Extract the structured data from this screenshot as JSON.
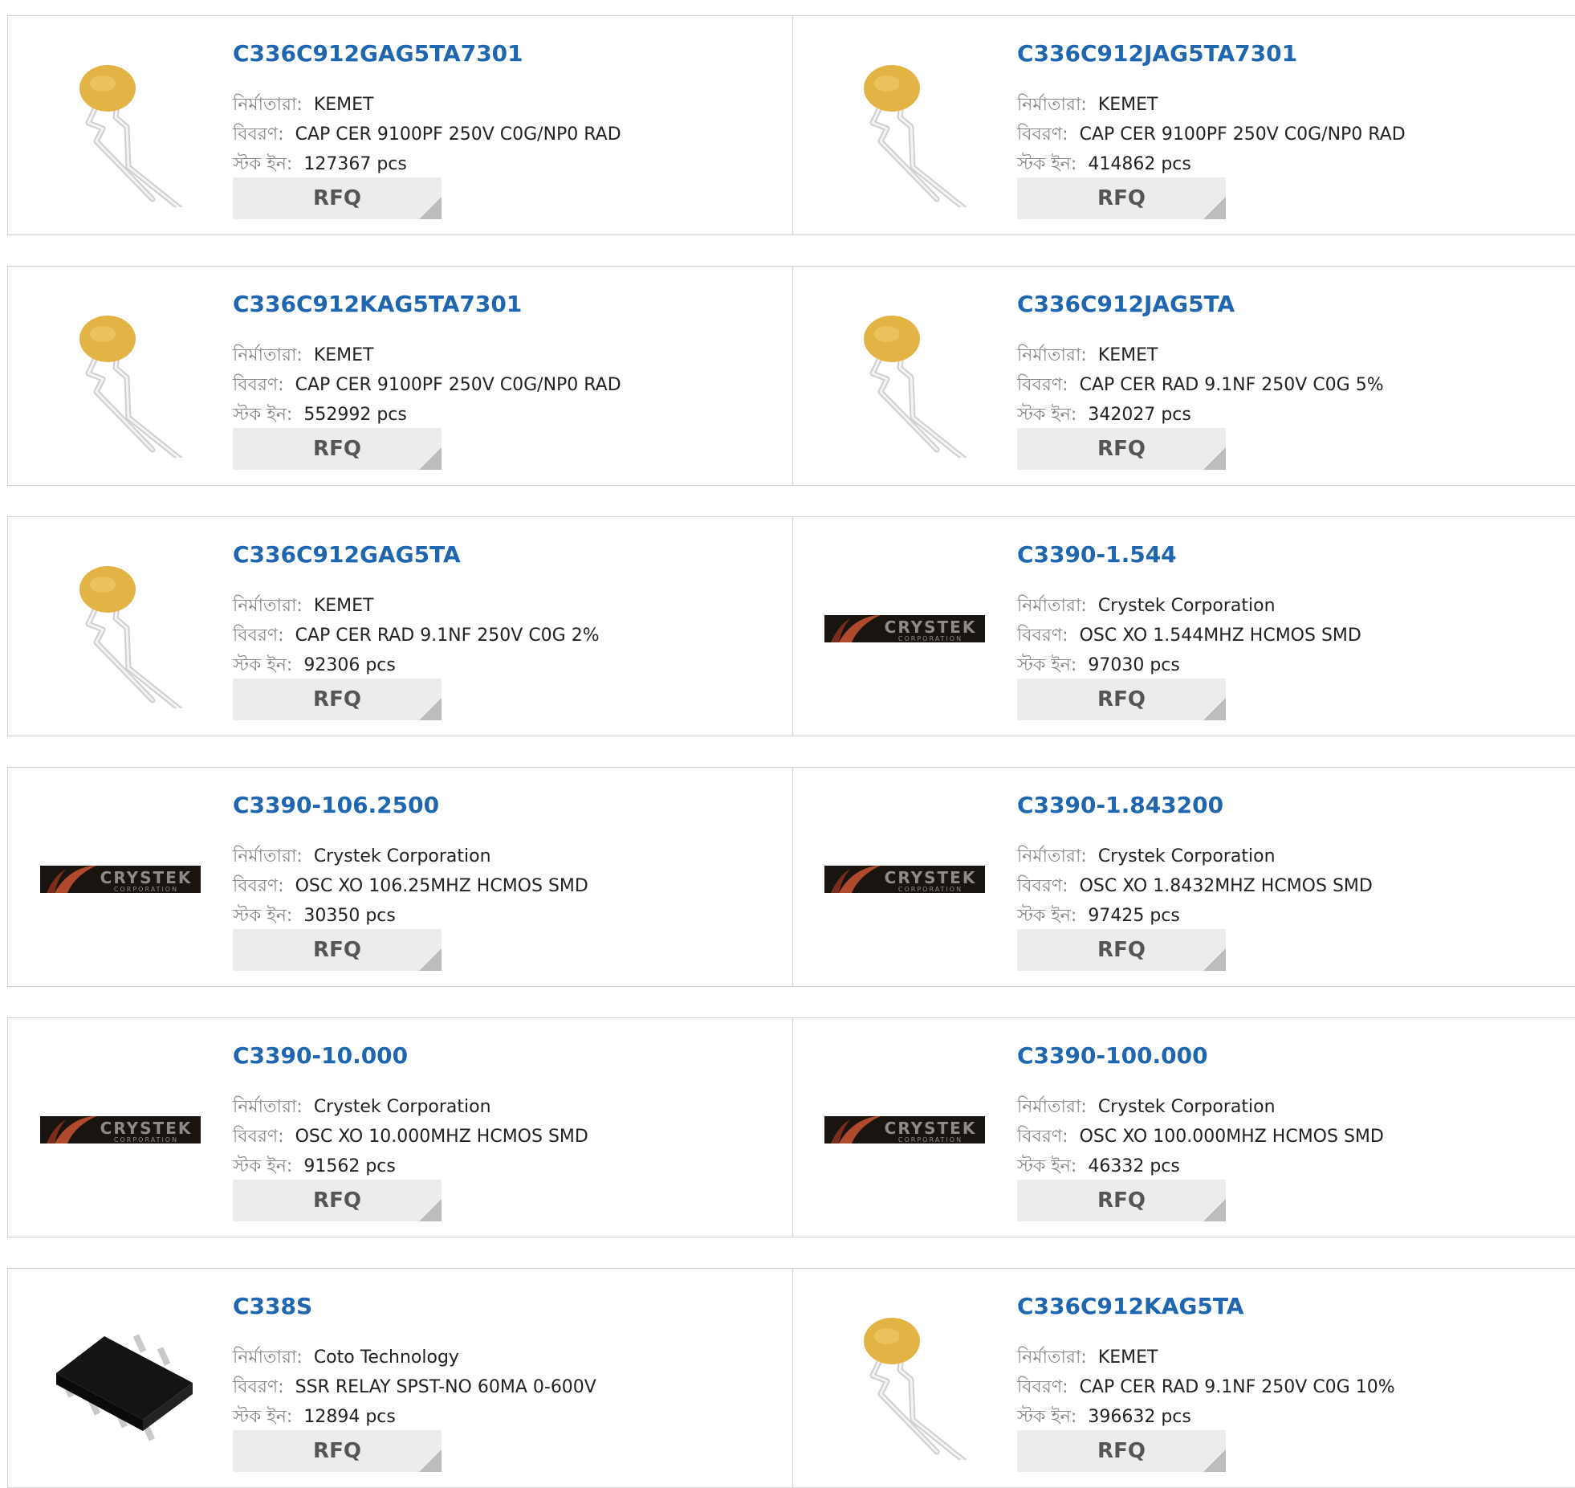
{
  "labels": {
    "manufacturer": "নির্মাতারা:",
    "description": "বিবরণ:",
    "stock": "স্টক ইন:",
    "rfq": "RFQ"
  },
  "colors": {
    "part_link": "#1f66b0",
    "border": "#d4d4d4",
    "rfq_bg": "#ececec"
  },
  "products": [
    {
      "part": "C336C912GAG5TA7301",
      "manufacturer": "KEMET",
      "description": "CAP CER 9100PF 250V C0G/NP0 RAD",
      "stock": "127367 pcs",
      "image": "ceramic-capacitor"
    },
    {
      "part": "C336C912JAG5TA7301",
      "manufacturer": "KEMET",
      "description": "CAP CER 9100PF 250V C0G/NP0 RAD",
      "stock": "414862 pcs",
      "image": "ceramic-capacitor"
    },
    {
      "part": "C336C912KAG5TA7301",
      "manufacturer": "KEMET",
      "description": "CAP CER 9100PF 250V C0G/NP0 RAD",
      "stock": "552992 pcs",
      "image": "ceramic-capacitor"
    },
    {
      "part": "C336C912JAG5TA",
      "manufacturer": "KEMET",
      "description": "CAP CER RAD 9.1NF 250V C0G 5%",
      "stock": "342027 pcs",
      "image": "ceramic-capacitor"
    },
    {
      "part": "C336C912GAG5TA",
      "manufacturer": "KEMET",
      "description": "CAP CER RAD 9.1NF 250V C0G 2%",
      "stock": "92306 pcs",
      "image": "ceramic-capacitor"
    },
    {
      "part": "C3390-1.544",
      "manufacturer": "Crystek Corporation",
      "description": "OSC XO 1.544MHZ HCMOS SMD",
      "stock": "97030 pcs",
      "image": "crystek-logo"
    },
    {
      "part": "C3390-106.2500",
      "manufacturer": "Crystek Corporation",
      "description": "OSC XO 106.25MHZ HCMOS SMD",
      "stock": "30350 pcs",
      "image": "crystek-logo"
    },
    {
      "part": "C3390-1.843200",
      "manufacturer": "Crystek Corporation",
      "description": "OSC XO 1.8432MHZ HCMOS SMD",
      "stock": "97425 pcs",
      "image": "crystek-logo"
    },
    {
      "part": "C3390-10.000",
      "manufacturer": "Crystek Corporation",
      "description": "OSC XO 10.000MHZ HCMOS SMD",
      "stock": "91562 pcs",
      "image": "crystek-logo"
    },
    {
      "part": "C3390-100.000",
      "manufacturer": "Crystek Corporation",
      "description": "OSC XO 100.000MHZ HCMOS SMD",
      "stock": "46332 pcs",
      "image": "crystek-logo"
    },
    {
      "part": "C338S",
      "manufacturer": "Coto Technology",
      "description": "SSR RELAY SPST-NO 60MA 0-600V",
      "stock": "12894 pcs",
      "image": "smd-relay-chip"
    },
    {
      "part": "C336C912KAG5TA",
      "manufacturer": "KEMET",
      "description": "CAP CER RAD 9.1NF 250V C0G 10%",
      "stock": "396632 pcs",
      "image": "ceramic-capacitor"
    }
  ],
  "logo_text": {
    "crystek_main": "CRYSTEK",
    "crystek_sub": "CORPORATION"
  }
}
